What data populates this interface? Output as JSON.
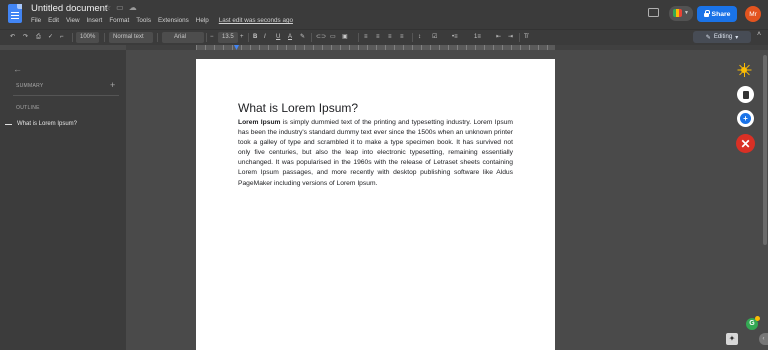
{
  "window": {
    "doc_title": "Untitled document",
    "last_edit": "Last edit was seconds ago"
  },
  "menus": [
    "File",
    "Edit",
    "View",
    "Insert",
    "Format",
    "Tools",
    "Extensions",
    "Help"
  ],
  "header": {
    "share_label": "Share",
    "avatar_initials": "Mr"
  },
  "toolbar": {
    "undo": "↶",
    "redo": "↷",
    "print": "⎙",
    "zoom": "100%",
    "style": "Normal text",
    "font": "Arial",
    "minus": "−",
    "font_size": "13.5",
    "plus": "+",
    "bold": "B",
    "italic": "I",
    "underline": "U",
    "text_color": "A",
    "editing_label": "Editing",
    "pencil": "✎"
  },
  "sidebar": {
    "back": "←",
    "summary_label": "SUMMARY",
    "summary_add": "+",
    "outline_label": "OUTLINE",
    "outline_items": [
      "What is Lorem Ipsum?"
    ]
  },
  "document": {
    "heading": "What is Lorem Ipsum?",
    "lead": "Lorem Ipsum",
    "body": " is simply dummied text of the printing and typesetting industry. Lorem Ipsum has been the industry's standard dummy text ever since the 1500s when an unknown printer took a galley of type and scrambled it to make a type specimen book. It has survived not only five centuries, but also the leap into electronic typesetting, remaining essentially unchanged. It was popularised in the 1960s with the release of Letraset sheets containing Lorem Ipsum passages, and more recently with desktop publishing software like Aldus PageMaker including versions of Lorem Ipsum."
  },
  "colors": {
    "share": "#1a73e8",
    "avatar": "#e3541f",
    "close": "#d93025"
  }
}
